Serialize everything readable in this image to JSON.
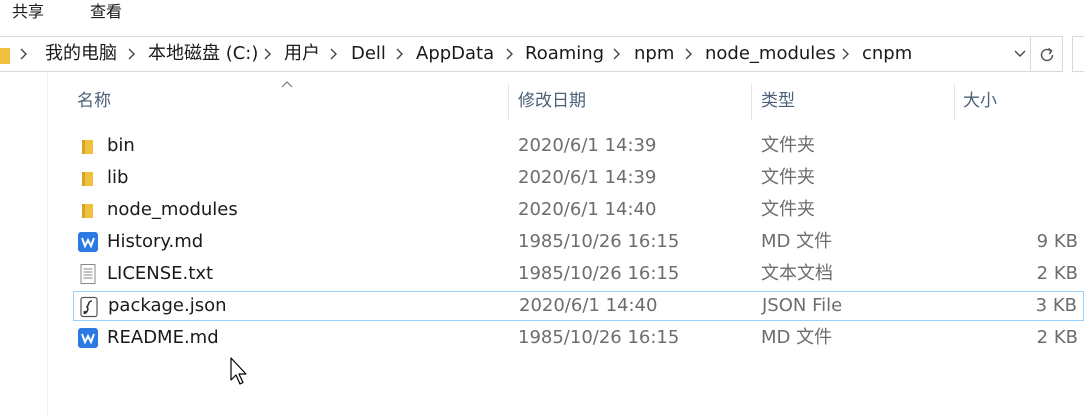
{
  "ribbon": {
    "tabs": [
      {
        "label": "共享"
      },
      {
        "label": "查看"
      }
    ]
  },
  "address": {
    "breadcrumbs": [
      "我的电脑",
      "本地磁盘 (C:)",
      "用户",
      "Dell",
      "AppData",
      "Roaming",
      "npm",
      "node_modules",
      "cnpm"
    ]
  },
  "columns": {
    "name": "名称",
    "date": "修改日期",
    "type": "类型",
    "size": "大小"
  },
  "files": [
    {
      "name": "bin",
      "date": "2020/6/1 14:39",
      "type": "文件夹",
      "size": "",
      "icon": "folder-icon"
    },
    {
      "name": "lib",
      "date": "2020/6/1 14:39",
      "type": "文件夹",
      "size": "",
      "icon": "folder-icon"
    },
    {
      "name": "node_modules",
      "date": "2020/6/1 14:40",
      "type": "文件夹",
      "size": "",
      "icon": "folder-icon"
    },
    {
      "name": "History.md",
      "date": "1985/10/26 16:15",
      "type": "MD 文件",
      "size": "9 KB",
      "icon": "wps-doc-icon"
    },
    {
      "name": "LICENSE.txt",
      "date": "1985/10/26 16:15",
      "type": "文本文档",
      "size": "2 KB",
      "icon": "text-file-icon"
    },
    {
      "name": "package.json",
      "date": "2020/6/1 14:40",
      "type": "JSON File",
      "size": "3 KB",
      "icon": "json-file-icon",
      "selected": true
    },
    {
      "name": "README.md",
      "date": "1985/10/26 16:15",
      "type": "MD 文件",
      "size": "2 KB",
      "icon": "wps-doc-icon"
    }
  ],
  "colors": {
    "folder": "#f0c040",
    "wps": "#2a7ae2",
    "selection_border": "#99d1ff",
    "header_text": "#4c607a"
  }
}
